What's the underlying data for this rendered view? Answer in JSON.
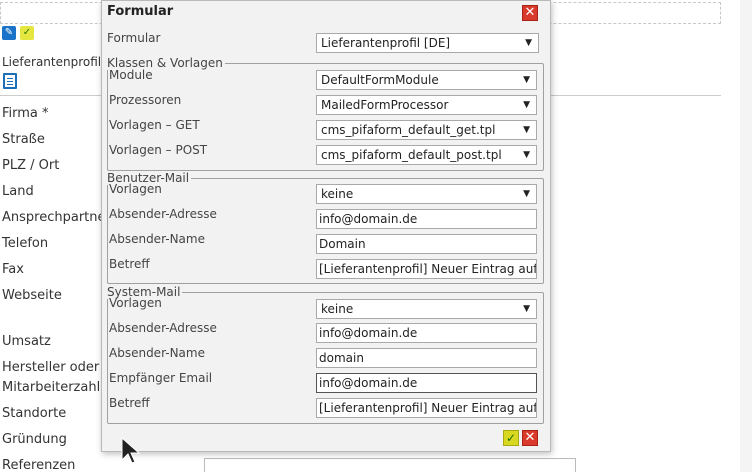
{
  "background": {
    "section_label": "Lieferantenprofil",
    "fields": [
      {
        "label": "Firma *"
      },
      {
        "label": "Straße"
      },
      {
        "label": "PLZ / Ort"
      },
      {
        "label": "Land"
      },
      {
        "label": "Ansprechpartner"
      },
      {
        "label": "Telefon"
      },
      {
        "label": "Fax"
      },
      {
        "label": "Webseite"
      },
      {
        "label": "Umsatz"
      },
      {
        "label": "Hersteller oder Händler"
      },
      {
        "label": "Mitarbeiterzahl"
      },
      {
        "label": "Standorte"
      },
      {
        "label": "Gründung"
      },
      {
        "label": "Referenzen"
      }
    ]
  },
  "dialog": {
    "title": "Formular",
    "form": {
      "label": "Formular",
      "value": "Lieferantenprofil [DE]"
    },
    "classes": {
      "legend": "Klassen & Vorlagen",
      "module": {
        "label": "Module",
        "value": "DefaultFormModule"
      },
      "processors": {
        "label": "Prozessoren",
        "value": "MailedFormProcessor"
      },
      "tpl_get": {
        "label": "Vorlagen – GET",
        "value": "cms_pifaform_default_get.tpl"
      },
      "tpl_post": {
        "label": "Vorlagen – POST",
        "value": "cms_pifaform_default_post.tpl"
      }
    },
    "user_mail": {
      "legend": "Benutzer-Mail",
      "templates": {
        "label": "Vorlagen",
        "value": "keine"
      },
      "sender_address": {
        "label": "Absender-Adresse",
        "value": "info@domain.de"
      },
      "sender_name": {
        "label": "Absender-Name",
        "value": "Domain"
      },
      "subject": {
        "label": "Betreff",
        "value": "[Lieferantenprofil] Neuer Eintrag auf Di"
      }
    },
    "system_mail": {
      "legend": "System-Mail",
      "templates": {
        "label": "Vorlagen",
        "value": "keine"
      },
      "sender_address": {
        "label": "Absender-Adresse",
        "value": "info@domain.de"
      },
      "sender_name": {
        "label": "Absender-Name",
        "value": "domain"
      },
      "recipient": {
        "label": "Empfänger Email",
        "value": "info@domain.de"
      },
      "subject": {
        "label": "Betreff",
        "value": "[Lieferantenprofil] Neuer Eintrag auf Di"
      }
    },
    "icons": {
      "close": "close-icon",
      "ok": "checkmark-icon",
      "arrow": "▼"
    }
  },
  "colors": {
    "close": "#d93a2b",
    "ok": "#d8d822",
    "edit": "#1a73c8"
  }
}
